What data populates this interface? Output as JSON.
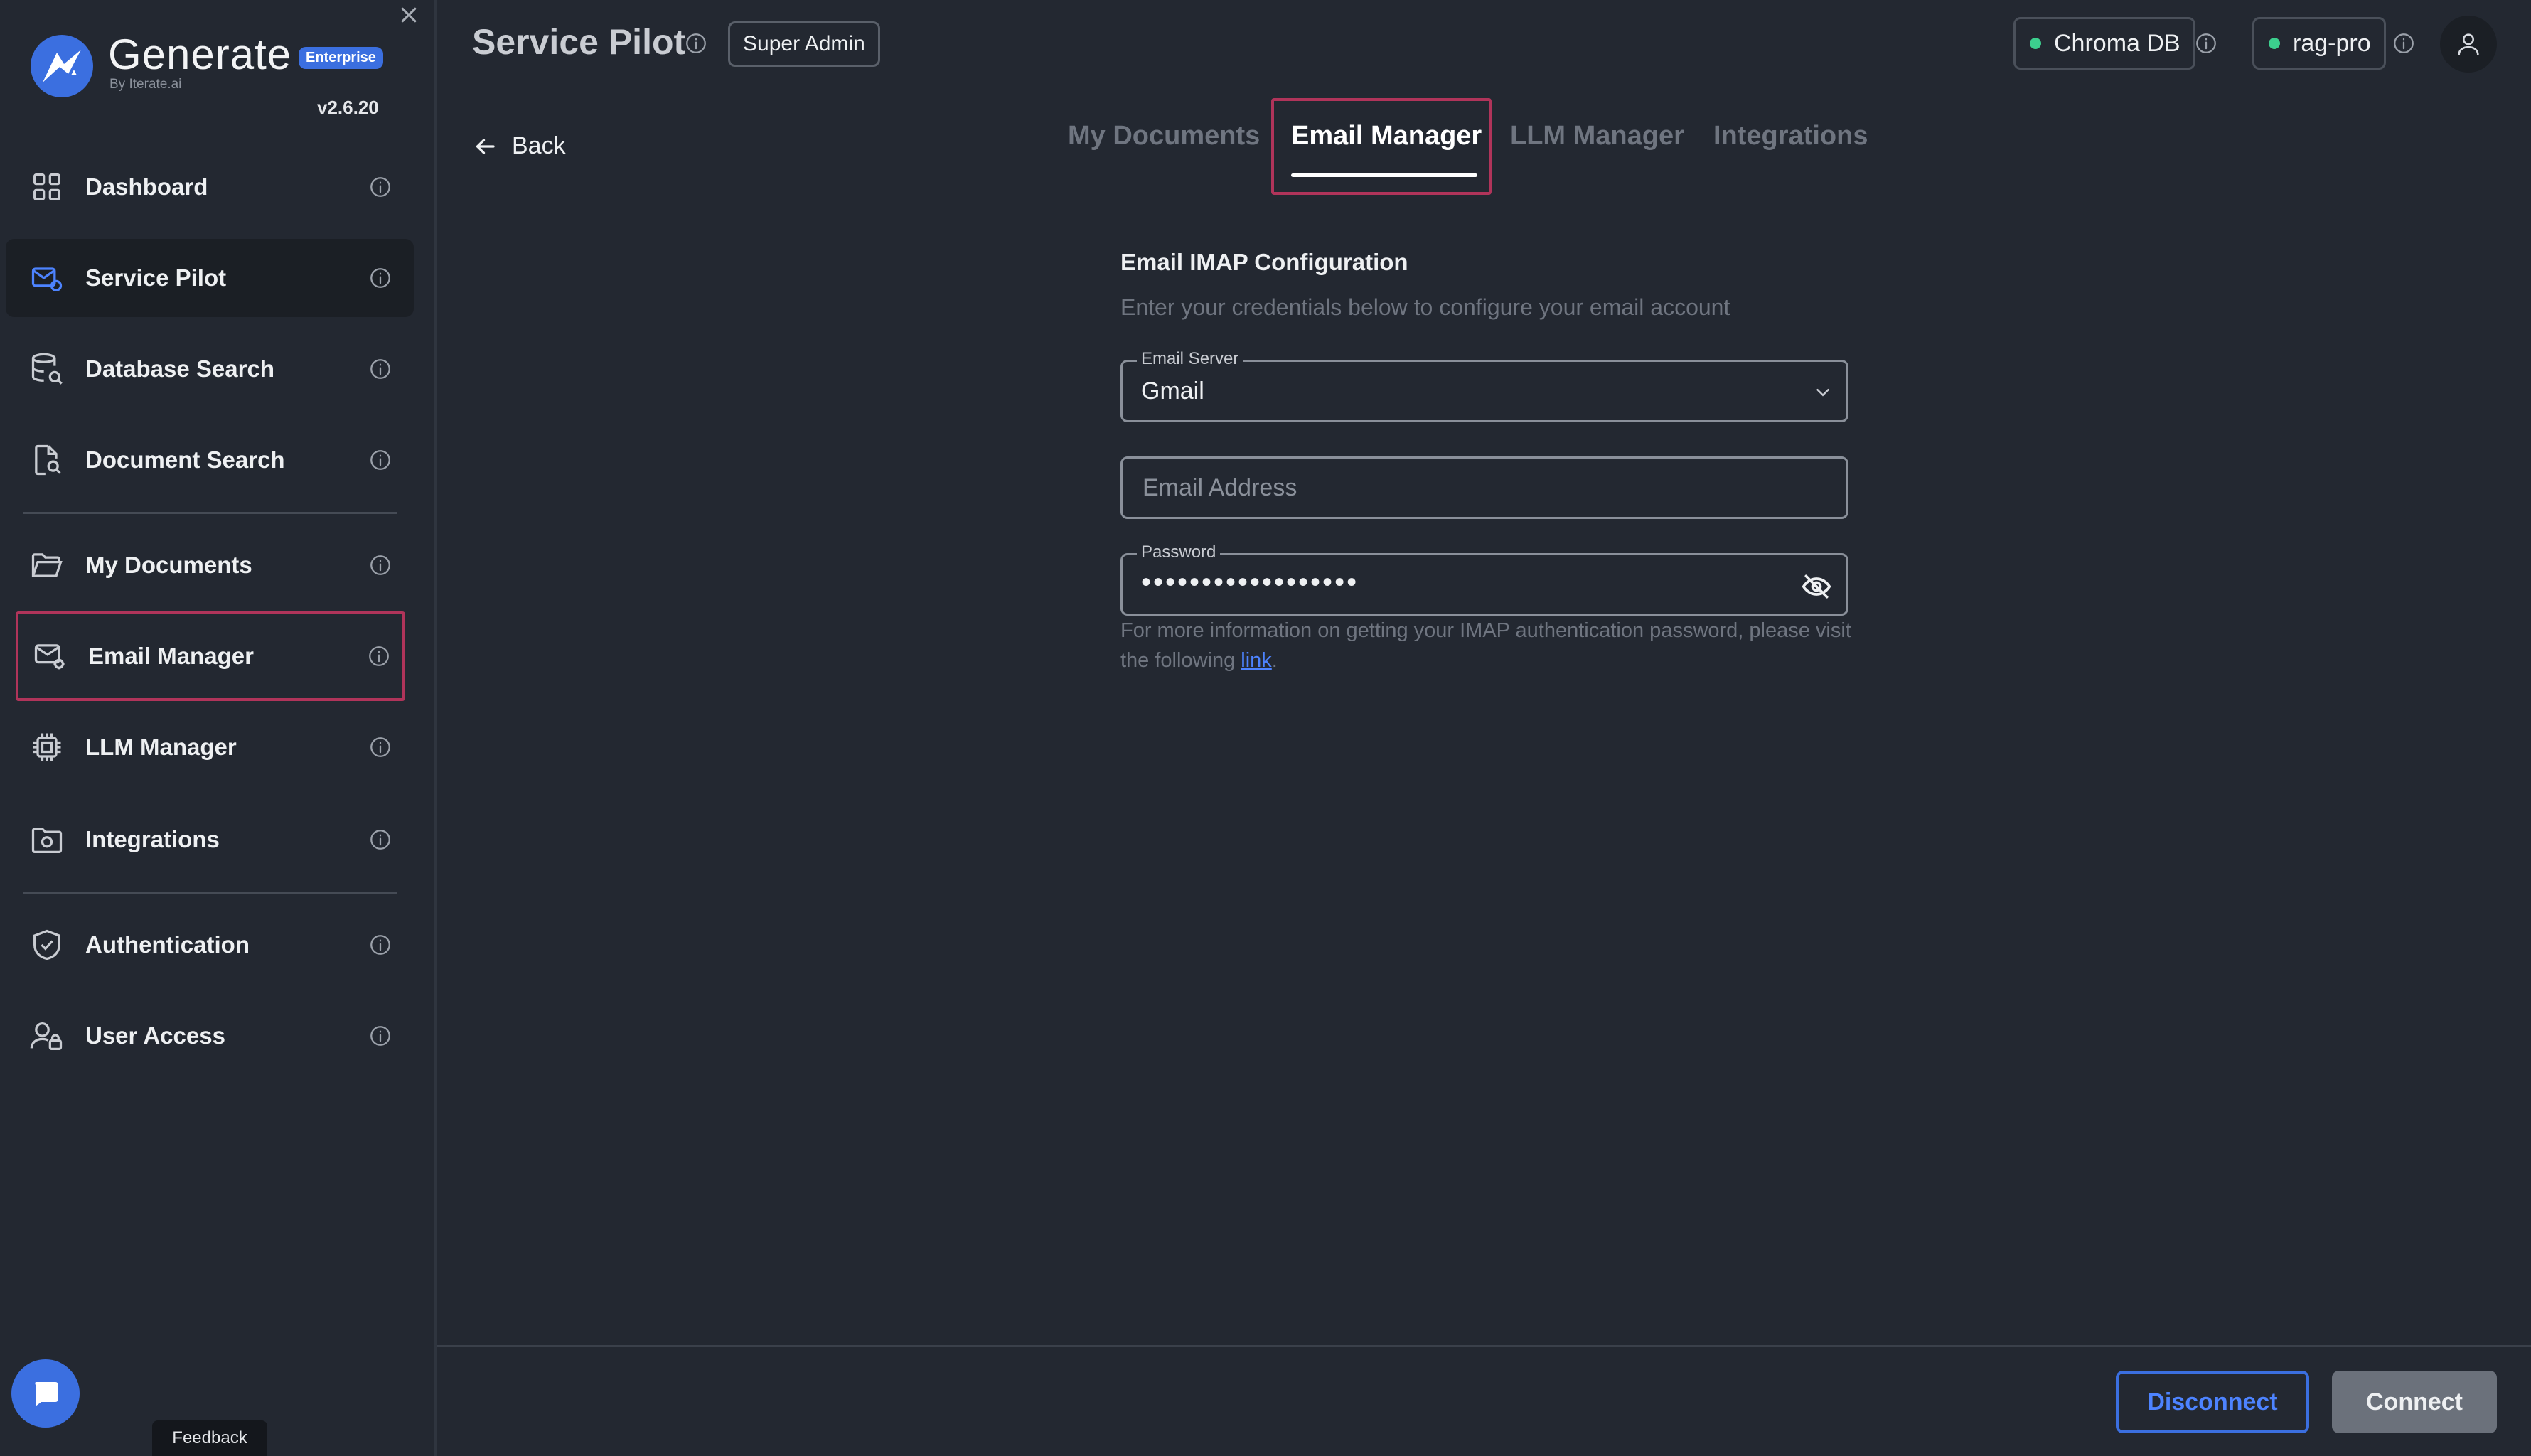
{
  "app": {
    "brand": "Generate",
    "brand_badge": "Enterprise",
    "brand_sub": "By Iterate.ai",
    "version": "v2.6.20"
  },
  "sidebar": {
    "items": [
      {
        "label": "Dashboard",
        "icon": "grid-icon"
      },
      {
        "label": "Service Pilot",
        "icon": "service-pilot-icon"
      },
      {
        "label": "Database Search",
        "icon": "database-search-icon"
      },
      {
        "label": "Document Search",
        "icon": "document-search-icon"
      },
      {
        "label": "My Documents",
        "icon": "folder-icon"
      },
      {
        "label": "Email Manager",
        "icon": "email-gear-icon"
      },
      {
        "label": "LLM Manager",
        "icon": "chip-icon"
      },
      {
        "label": "Integrations",
        "icon": "integrations-icon"
      },
      {
        "label": "Authentication",
        "icon": "shield-check-icon"
      },
      {
        "label": "User Access",
        "icon": "user-lock-icon"
      }
    ],
    "feedback": "Feedback"
  },
  "header": {
    "title": "Service Pilot",
    "role": "Super Admin",
    "db_status": "Chroma DB",
    "project_status": "rag-pro",
    "status_color": "#3ccf8e"
  },
  "nav": {
    "back": "Back",
    "tabs": [
      "My Documents",
      "Email Manager",
      "LLM Manager",
      "Integrations"
    ],
    "active_tab": "Email Manager"
  },
  "form": {
    "title": "Email IMAP Configuration",
    "subtitle": "Enter your credentials below to configure your email account",
    "server_label": "Email Server",
    "server_value": "Gmail",
    "email_placeholder": "Email Address",
    "password_label": "Password",
    "password_value": "••••••••••••••••••",
    "help_prefix": "For more information on getting your IMAP authentication password, please visit the following ",
    "help_link": "link",
    "help_suffix": "."
  },
  "footer": {
    "disconnect": "Disconnect",
    "connect": "Connect"
  },
  "colors": {
    "accent": "#3b6fe0",
    "highlight": "#b0345a",
    "background": "#232831"
  }
}
